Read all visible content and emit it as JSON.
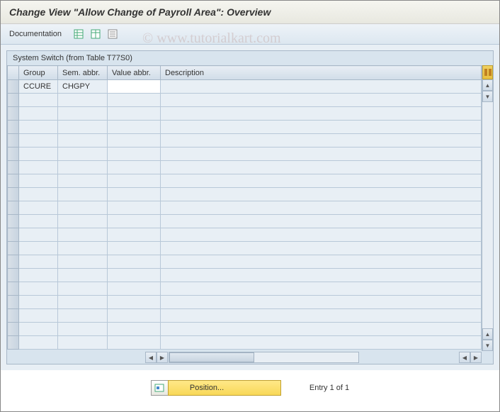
{
  "title": "Change View \"Allow Change of Payroll Area\": Overview",
  "toolbar": {
    "documentation_label": "Documentation"
  },
  "table": {
    "title": "System Switch (from Table T77S0)",
    "headers": {
      "group": "Group",
      "sem_abbr": "Sem. abbr.",
      "value_abbr": "Value abbr.",
      "description": "Description"
    },
    "rows": [
      {
        "group": "CCURE",
        "sem_abbr": "CHGPY",
        "value_abbr": "",
        "description": ""
      }
    ]
  },
  "footer": {
    "position_label": "Position...",
    "entry_text": "Entry 1 of 1"
  },
  "watermark": "© www.tutorialkart.com"
}
